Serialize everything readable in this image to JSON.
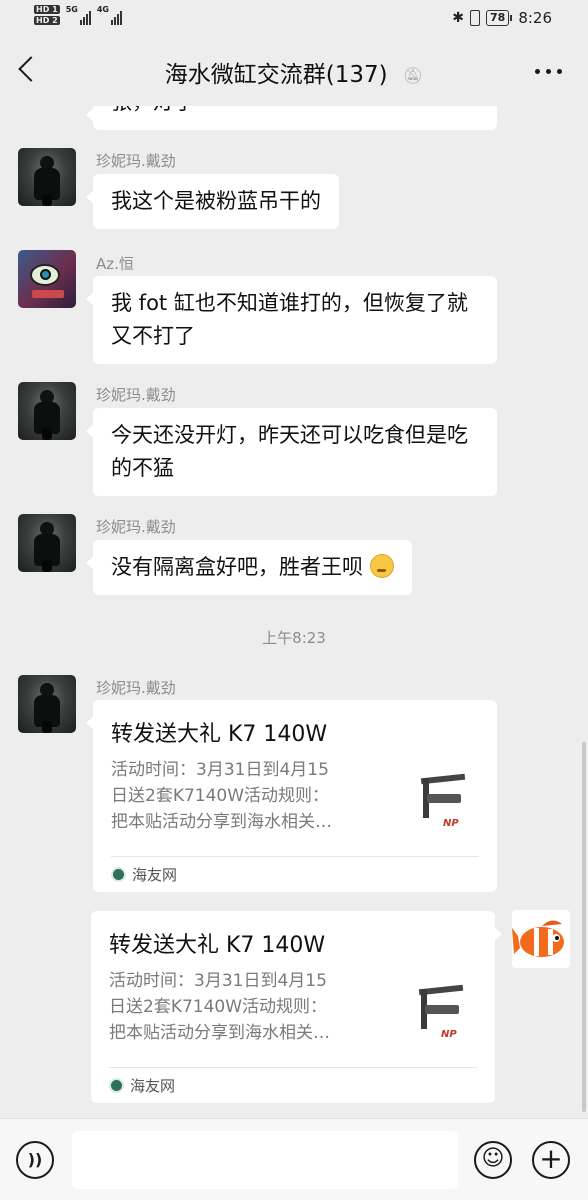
{
  "status_bar": {
    "sim1": "HD 1",
    "sim2": "HD 2",
    "net1": "5G",
    "net2": "4G",
    "bluetooth_icon": "bluetooth-icon",
    "battery": "78",
    "time": "8:26"
  },
  "header": {
    "title": "海水微缸交流群(137)",
    "mute_icon": "bell-off-icon",
    "back_icon": "chevron-left-icon",
    "more_icon": "more-icon"
  },
  "messages": [
    {
      "type": "text",
      "text": "张，灯了"
    },
    {
      "type": "text",
      "sender": "珍妮玛.戴劲",
      "text": "我这个是被粉蓝吊干的"
    },
    {
      "type": "text",
      "sender": "Az.恒",
      "text": "我 fot 缸也不知道谁打的，但恢复了就又不打了"
    },
    {
      "type": "text",
      "sender": "珍妮玛.戴劲",
      "text": "今天还没开灯，昨天还可以吃食但是吃的不猛"
    },
    {
      "type": "text",
      "sender": "珍妮玛.戴劲",
      "text": "没有隔离盒好吧，胜者王呗",
      "emoji": "thinking-face-emoji"
    }
  ],
  "timestamp": "上午8:23",
  "shared_cards": [
    {
      "sender": "珍妮玛.戴劲",
      "title": "转发送大礼 K7 140W",
      "desc_line1": "活动时间：3月31日到4月15",
      "desc_line2": "日送2套K7140W活动规则：",
      "desc_line3": "把本贴活动分享到海水相关…",
      "source": "海友网",
      "thumb_logo": "NP"
    },
    {
      "title": "转发送大礼 K7 140W",
      "desc_line1": "活动时间：3月31日到4月15",
      "desc_line2": "日送2套K7140W活动规则：",
      "desc_line3": "把本贴活动分享到海水相关…",
      "source": "海友网",
      "thumb_logo": "NP"
    }
  ],
  "input_bar": {
    "voice_icon": "voice-icon",
    "emoji_icon": "emoji-icon",
    "plus_icon": "plus-icon"
  },
  "colors": {
    "background": "#ededed",
    "bubble": "#ffffff",
    "meta_text": "#8c8c8c"
  }
}
